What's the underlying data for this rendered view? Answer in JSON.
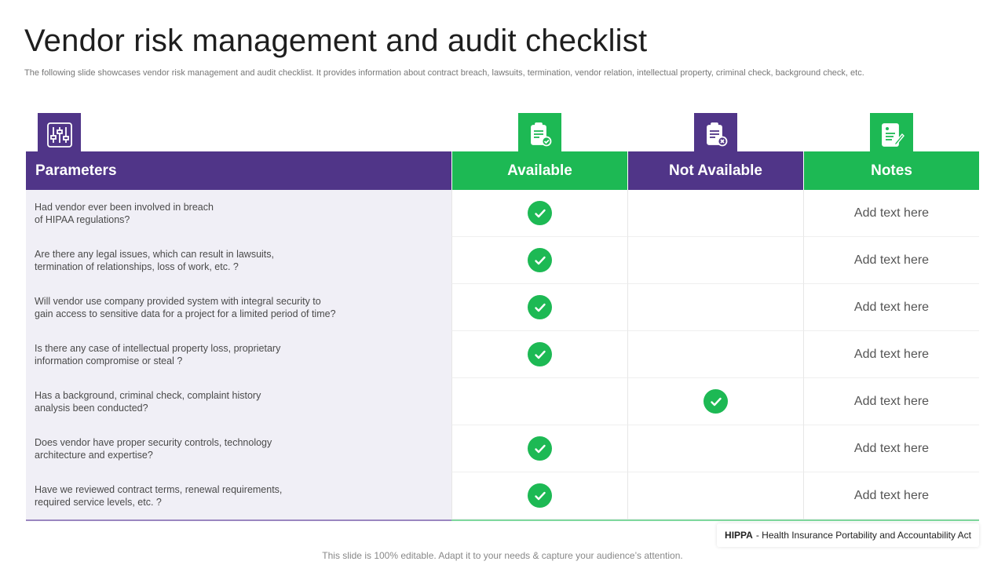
{
  "title": "Vendor risk management and audit checklist",
  "subtitle": "The following slide showcases vendor risk management and audit checklist. It provides information about contract breach, lawsuits, termination, vendor relation, intellectual property, criminal check, background check, etc.",
  "colors": {
    "purple": "#503588",
    "green": "#1db954",
    "param_bg": "#f0eff6"
  },
  "icons": {
    "parameters": "sliders-icon",
    "available": "clipboard-check-icon",
    "not_available": "clipboard-x-icon",
    "notes": "notes-pen-icon"
  },
  "headers": {
    "parameters": "Parameters",
    "available": "Available",
    "not_available": "Not Available",
    "notes": "Notes"
  },
  "rows": [
    {
      "param": "Had vendor  ever  been involved  in breach\nof HIPAA regulations?",
      "available": true,
      "not_available": false,
      "note": "Add text here"
    },
    {
      "param": "Are there any legal issues, which can result in lawsuits,\ntermination of relationships, loss of work, etc. ?",
      "available": true,
      "not_available": false,
      "note": "Add text here"
    },
    {
      "param": "Will vendor  use company provided  system with integral security to\ngain access to sensitive data for a project for a limited period of time?",
      "available": true,
      "not_available": false,
      "note": "Add text here"
    },
    {
      "param": "Is there any case of intellectual property  loss, proprietary\ninformation  compromise or steal ?",
      "available": true,
      "not_available": false,
      "note": "Add text here"
    },
    {
      "param": "Has a background,  criminal check, complaint history\nanalysis been conducted?",
      "available": false,
      "not_available": true,
      "note": "Add text here"
    },
    {
      "param": "Does vendor  have  proper  security controls, technology\narchitecture  and expertise?",
      "available": true,
      "not_available": false,
      "note": "Add text here"
    },
    {
      "param": "Have  we reviewed  contract terms, renewal requirements,\nrequired  service levels, etc. ?",
      "available": true,
      "not_available": false,
      "note": "Add text here"
    }
  ],
  "legend": {
    "term": "HIPPA",
    "definition": "- Health Insurance Portability and Accountability Act"
  },
  "footer": "This slide is 100% editable. Adapt it to your needs & capture your audience’s attention."
}
